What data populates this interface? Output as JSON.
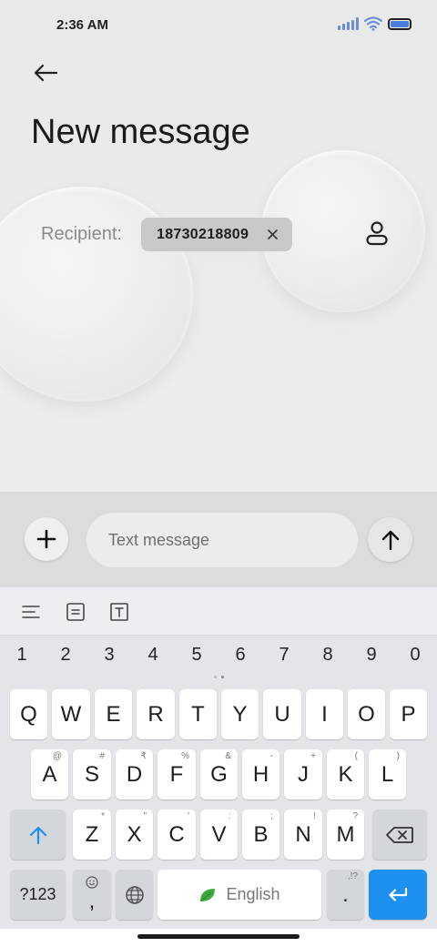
{
  "status_bar": {
    "time": "2:36 AM"
  },
  "header": {
    "title": "New message"
  },
  "recipient": {
    "label": "Recipient:",
    "chip_number": "18730218809"
  },
  "compose": {
    "placeholder": "Text message"
  },
  "keyboard": {
    "numbers": [
      "1",
      "2",
      "3",
      "4",
      "5",
      "6",
      "7",
      "8",
      "9",
      "0"
    ],
    "row1": [
      {
        "main": "Q"
      },
      {
        "main": "W"
      },
      {
        "main": "E"
      },
      {
        "main": "R"
      },
      {
        "main": "T"
      },
      {
        "main": "Y"
      },
      {
        "main": "U"
      },
      {
        "main": "I"
      },
      {
        "main": "O"
      },
      {
        "main": "P"
      }
    ],
    "row2": [
      {
        "main": "A",
        "sup": "@"
      },
      {
        "main": "S",
        "sup": "#"
      },
      {
        "main": "D",
        "sup": "₹"
      },
      {
        "main": "F",
        "sup": "%"
      },
      {
        "main": "G",
        "sup": "&"
      },
      {
        "main": "H",
        "sup": "-"
      },
      {
        "main": "J",
        "sup": "+"
      },
      {
        "main": "K",
        "sup": "("
      },
      {
        "main": "L",
        "sup": ")"
      }
    ],
    "row3": [
      {
        "main": "Z",
        "sup": "*"
      },
      {
        "main": "X",
        "sup": "\""
      },
      {
        "main": "C",
        "sup": "'"
      },
      {
        "main": "V",
        "sup": ":"
      },
      {
        "main": "B",
        "sup": ";"
      },
      {
        "main": "N",
        "sup": "!"
      },
      {
        "main": "M",
        "sup": "?"
      }
    ],
    "symbols_label": "?123",
    "comma": ",",
    "space_label": "English",
    "period": ".",
    "period_sup": ",!?"
  },
  "colors": {
    "accent": "#1e90f0",
    "chip": "#c8c8c8",
    "signal": "#6a8fd8"
  }
}
